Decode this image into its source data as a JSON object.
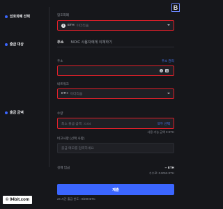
{
  "close_label": "B",
  "steps": {
    "select_asset": "암호화폐 선택",
    "withdraw_target": "출금 대상",
    "withdraw_amount": "출금 금액"
  },
  "asset": {
    "label": "암호화폐",
    "coin_symbol": "ETH",
    "coin_name": "이더리움",
    "coin_badge": "Ξ"
  },
  "tabs": [
    {
      "label": "주소"
    },
    {
      "label": "MOIC 사용자에게 이체하기"
    }
  ],
  "address": {
    "label": "주소",
    "link": "주소 관리",
    "value": "",
    "clear_icon": "×",
    "scan_icon": "⊡"
  },
  "network": {
    "label": "네트워크",
    "symbol": "ETH",
    "name": "이더리움"
  },
  "amount": {
    "label": "수량",
    "placeholder": "최소 출금 금액 : 0.04",
    "max_link": "모두 선택",
    "available": "사용 가능 금액 0 ETH"
  },
  "memo": {
    "label": "비고사항 (선택 사항)",
    "placeholder": "출금 메모를 입력하세요"
  },
  "receive": {
    "label": "실제 입금",
    "value": "-- ETH",
    "fee": "수수료: 0.0015 ETH"
  },
  "submit_label": "제출",
  "footer_note": "24 시간 출금 한도 : 0/200 BTC",
  "watermark": "© 94bit.com",
  "colors": {
    "accent": "#3b66ff",
    "highlight": "#e2202a"
  }
}
